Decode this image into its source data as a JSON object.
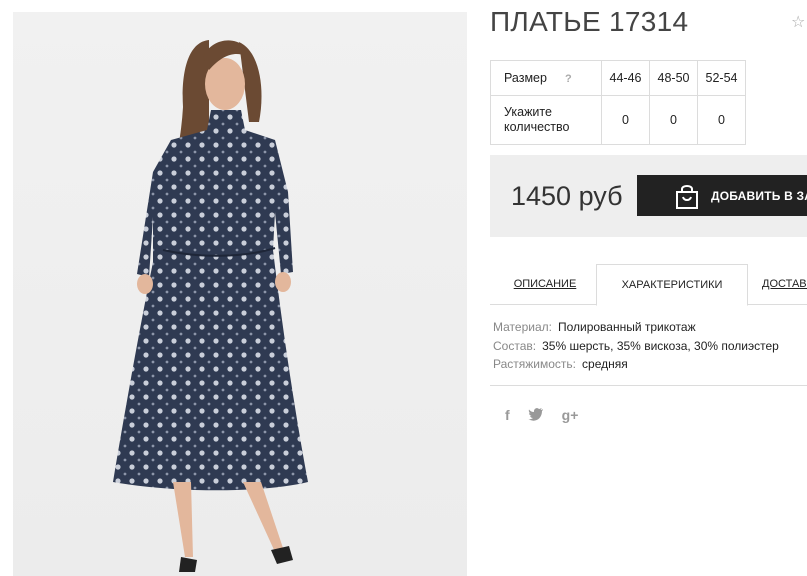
{
  "product": {
    "title": "ПЛАТЬЕ 17314"
  },
  "icons": {
    "favorite": "star-outline-icon",
    "help": "question-icon",
    "bag": "shopping-bag-icon"
  },
  "size_table": {
    "size_label": "Размер",
    "help_mark": "?",
    "sizes": [
      "44-46",
      "48-50",
      "52-54"
    ],
    "qty_label_1": "Укажите",
    "qty_label_2": "количество",
    "quantities": [
      "0",
      "0",
      "0"
    ]
  },
  "buy": {
    "price": "1450 руб",
    "add_label": "ДОБАВИТЬ В ЗАКАЗ"
  },
  "tabs": [
    {
      "label": "ОПИСАНИЕ"
    },
    {
      "label": "ХАРАКТЕРИСТИКИ"
    },
    {
      "label": "ДОСТАВКА"
    }
  ],
  "properties": [
    {
      "key": "Материал:",
      "value": "Полированный трикотаж"
    },
    {
      "key": "Состав:",
      "value": "35% шерсть, 35% вискоза, 30% полиэстер"
    },
    {
      "key": "Растяжимость:",
      "value": "средняя"
    }
  ],
  "social": {
    "facebook": "f",
    "twitter": "twitter-bird-icon",
    "googleplus": "g+"
  },
  "colors": {
    "button_bg": "#222222",
    "bar_bg": "#eeeeee",
    "dress": "#2f3a52"
  }
}
